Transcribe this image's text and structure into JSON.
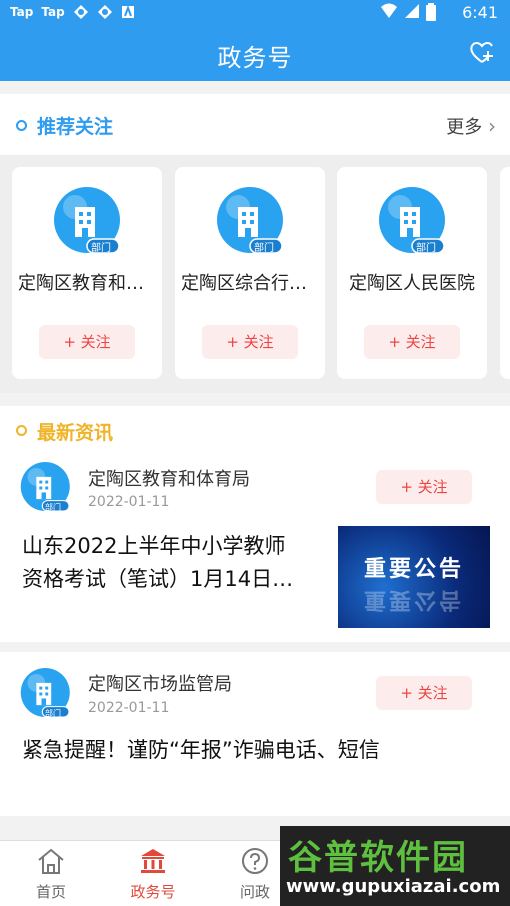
{
  "status_bar": {
    "left_icons": [
      "Tap",
      "Tap"
    ],
    "time": "6:41"
  },
  "app_bar": {
    "title": "政务号"
  },
  "recommend": {
    "title": "推荐关注",
    "more": "更多"
  },
  "cards": [
    {
      "name": "定陶区教育和体育局",
      "badge": "部门",
      "follow": "+ 关注"
    },
    {
      "name": "定陶区综合行政执法局",
      "badge": "部门",
      "follow": "+ 关注"
    },
    {
      "name": "定陶区人民医院",
      "badge": "部门",
      "follow": "+ 关注"
    }
  ],
  "latest": {
    "title": "最新资讯"
  },
  "news": [
    {
      "source": "定陶区教育和体育局",
      "date": "2022-01-11",
      "badge": "部门",
      "follow": "+ 关注",
      "headline_line1": "山东2022上半年中小学教师",
      "headline_line2": "资格考试（笔试）1月14日…",
      "thumb_text": "重要公告"
    },
    {
      "source": "定陶区市场监管局",
      "date": "2022-01-11",
      "badge": "部门",
      "follow": "+ 关注",
      "headline_line1": "紧急提醒！谨防“年报”诈骗电话、短信"
    }
  ],
  "tabs": [
    {
      "label": "首页",
      "icon": "home-icon"
    },
    {
      "label": "政务号",
      "icon": "government-building-icon"
    },
    {
      "label": "问政",
      "icon": "question-icon"
    }
  ],
  "watermark": {
    "line1": "谷普软件园",
    "line2": "www.gupuxiazai.com"
  },
  "colors": {
    "primary": "#2f9cf0",
    "accent_red": "#e04a3a",
    "follow_bg": "#fdecec",
    "section_dot_blue": "#2f9cf0",
    "section_dot_yellow": "#f0b429"
  }
}
